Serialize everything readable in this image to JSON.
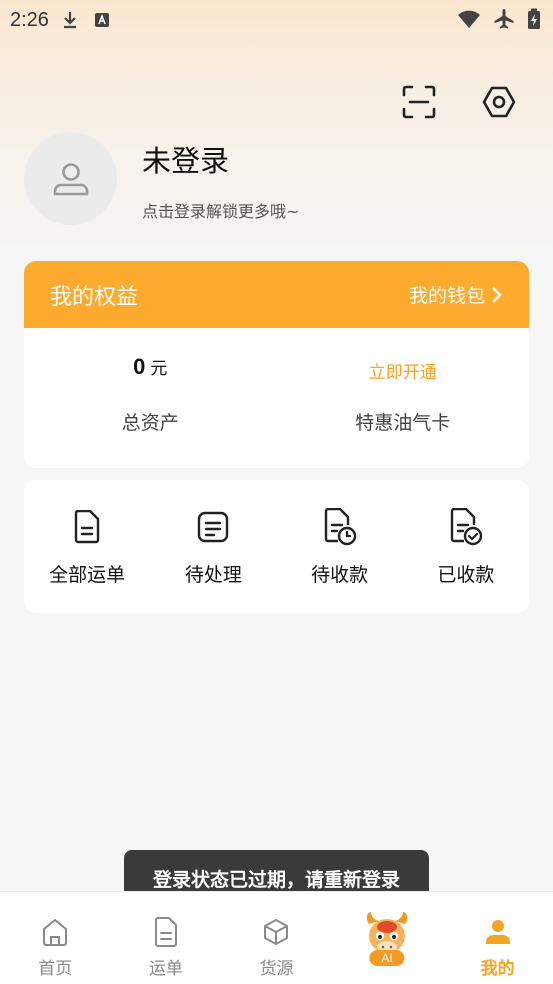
{
  "status_bar": {
    "time": "2:26"
  },
  "profile": {
    "name": "未登录",
    "hint": "点击登录解锁更多哦~"
  },
  "benefits": {
    "title": "我的权益",
    "wallet_link": "我的钱包",
    "total_assets_value": "0",
    "total_assets_unit": "元",
    "total_assets_label": "总资产",
    "open_link": "立即开通",
    "card_label": "特惠油气卡"
  },
  "orders": [
    {
      "label": "全部运单",
      "icon": "document-icon"
    },
    {
      "label": "待处理",
      "icon": "note-icon"
    },
    {
      "label": "待收款",
      "icon": "document-clock-icon"
    },
    {
      "label": "已收款",
      "icon": "document-check-icon"
    }
  ],
  "toast": "登录状态已过期，请重新登录",
  "tabs": [
    {
      "label": "首页",
      "icon": "home-icon"
    },
    {
      "label": "运单",
      "icon": "waybill-icon"
    },
    {
      "label": "货源",
      "icon": "cube-icon"
    },
    {
      "label": "AI",
      "icon": "ai-mascot-icon"
    },
    {
      "label": "我的",
      "icon": "user-icon",
      "active": true
    }
  ],
  "colors": {
    "accent": "#fdab2e",
    "link": "#f5a524"
  }
}
